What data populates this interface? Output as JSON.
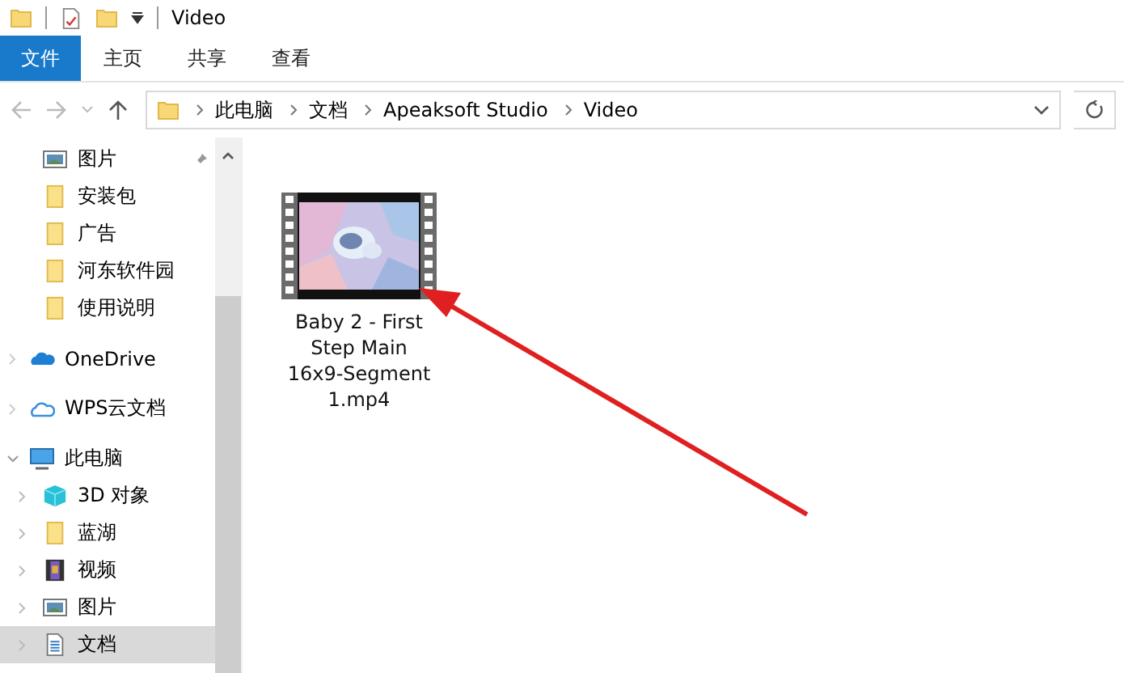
{
  "window": {
    "title": "Video"
  },
  "ribbon_tabs": [
    {
      "label": "文件",
      "kind": "file"
    },
    {
      "label": "主页",
      "kind": "tab"
    },
    {
      "label": "共享",
      "kind": "tab"
    },
    {
      "label": "查看",
      "kind": "tab"
    }
  ],
  "address_bar": {
    "crumbs": [
      "此电脑",
      "文档",
      "Apeaksoft Studio",
      "Video"
    ]
  },
  "navigation": {
    "quick_access": [
      {
        "label": "图片",
        "kind": "picture",
        "pinned": true
      },
      {
        "label": "安装包",
        "kind": "folder",
        "pinned": false
      },
      {
        "label": "广告",
        "kind": "folder",
        "pinned": false
      },
      {
        "label": "河东软件园",
        "kind": "folder",
        "pinned": false
      },
      {
        "label": "使用说明",
        "kind": "folder",
        "pinned": false
      }
    ],
    "roots": [
      {
        "label": "OneDrive",
        "kind": "onedrive",
        "expanded": false
      },
      {
        "label": "WPS云文档",
        "kind": "cloud",
        "expanded": false
      },
      {
        "label": "此电脑",
        "kind": "pc",
        "expanded": true,
        "children": [
          {
            "label": "3D 对象",
            "kind": "cube",
            "selected": false
          },
          {
            "label": "蓝湖",
            "kind": "folder",
            "selected": false
          },
          {
            "label": "视频",
            "kind": "video",
            "selected": false
          },
          {
            "label": "图片",
            "kind": "picture",
            "selected": false
          },
          {
            "label": "文档",
            "kind": "doc",
            "selected": true
          }
        ]
      }
    ]
  },
  "files": [
    {
      "name": "Baby 2 - First Step Main 16x9-Segment 1.mp4",
      "kind": "video"
    }
  ]
}
